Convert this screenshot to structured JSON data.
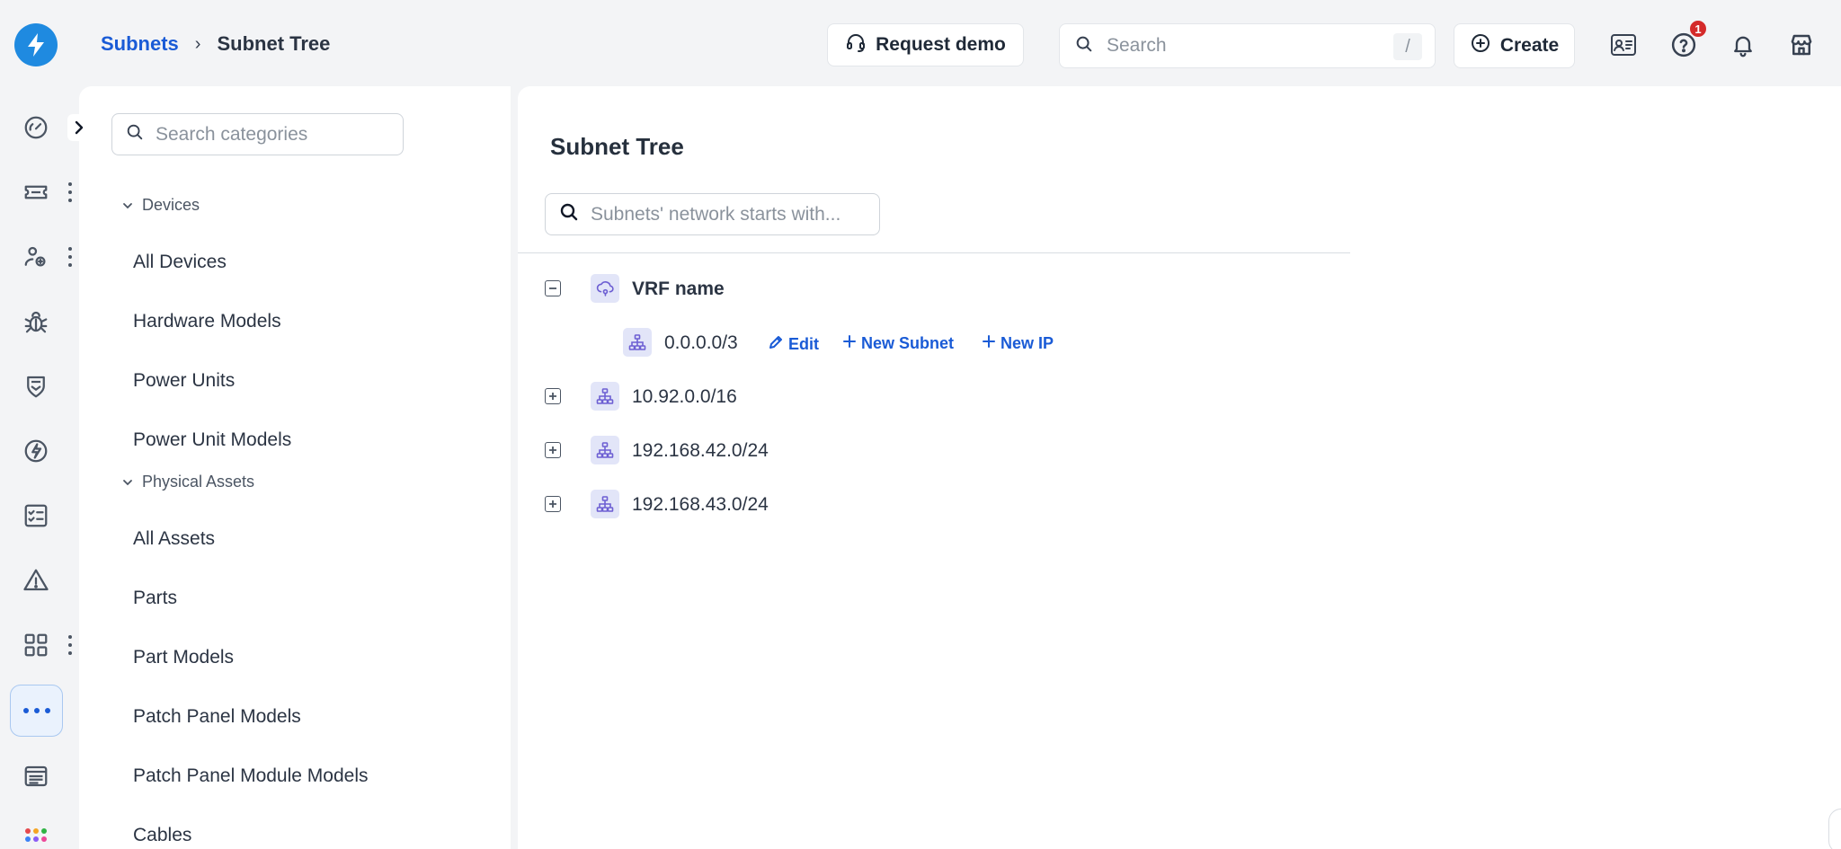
{
  "header": {
    "breadcrumb": {
      "parent": "Subnets",
      "separator": "›",
      "current": "Subnet Tree"
    },
    "request_demo_label": "Request demo",
    "search": {
      "placeholder": "Search",
      "shortcut": "/"
    },
    "create_label": "Create",
    "help_badge_count": "1"
  },
  "sidebar": {
    "search_placeholder": "Search categories",
    "groups": [
      {
        "label": "Devices",
        "items": [
          "All Devices",
          "Hardware Models",
          "Power Units",
          "Power Unit Models"
        ]
      },
      {
        "label": "Physical Assets",
        "items": [
          "All Assets",
          "Parts",
          "Part Models",
          "Patch Panel Models",
          "Patch Panel Module Models",
          "Cables"
        ]
      }
    ]
  },
  "main": {
    "title": "Subnet Tree",
    "tree_search_placeholder": "Subnets' network starts with...",
    "tree": {
      "vrf": {
        "label": "VRF name",
        "expanded": true
      },
      "child": {
        "label": "0.0.0.0/3",
        "actions": {
          "edit": "Edit",
          "new_subnet": "New Subnet",
          "new_ip": "New IP"
        }
      },
      "subnets": [
        "10.92.0.0/16",
        "192.168.42.0/24",
        "192.168.43.0/24"
      ]
    }
  },
  "colors": {
    "accent": "#1a5bd6",
    "logo": "#1f8ae0",
    "badge": "#d42a2a",
    "tree_icon_bg": "#e2e5f8",
    "tree_icon_fg": "#6d5fd3"
  }
}
